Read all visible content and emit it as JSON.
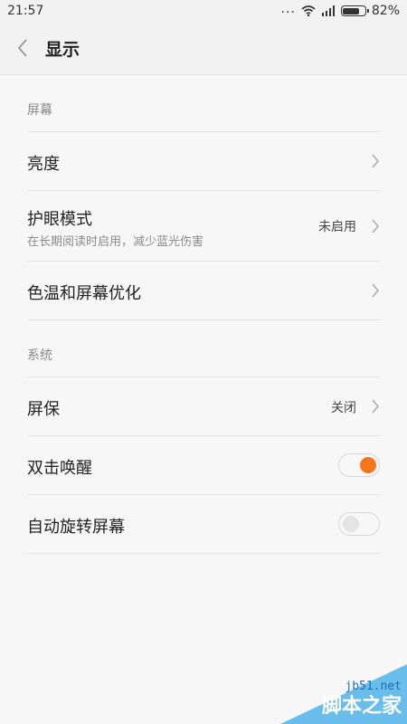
{
  "status_bar": {
    "time": "21:57",
    "dots": "...",
    "battery_percent": "82%",
    "battery_level": 0.82
  },
  "header": {
    "title": "显示"
  },
  "sections": [
    {
      "title": "屏幕",
      "items": [
        {
          "label": "亮度",
          "type": "link"
        },
        {
          "label": "护眼模式",
          "desc": "在长期阅读时启用，减少蓝光伤害",
          "value": "未启用",
          "type": "link"
        },
        {
          "label": "色温和屏幕优化",
          "type": "link"
        }
      ]
    },
    {
      "title": "系统",
      "items": [
        {
          "label": "屏保",
          "value": "关闭",
          "type": "link"
        },
        {
          "label": "双击唤醒",
          "type": "toggle",
          "on": true
        },
        {
          "label": "自动旋转屏幕",
          "type": "toggle",
          "on": false
        }
      ]
    }
  ],
  "watermark": {
    "line1": "jb51.net",
    "line2": "脚本之家"
  },
  "colors": {
    "accent": "#f7761d",
    "knob_off": "#e4e4e4",
    "chevron": "#aaaaaa"
  },
  "icons": {
    "back": "chevron-left-icon",
    "wifi": "wifi-icon",
    "signal": "signal-icon",
    "battery": "battery-icon",
    "chevron": "chevron-right-icon"
  }
}
